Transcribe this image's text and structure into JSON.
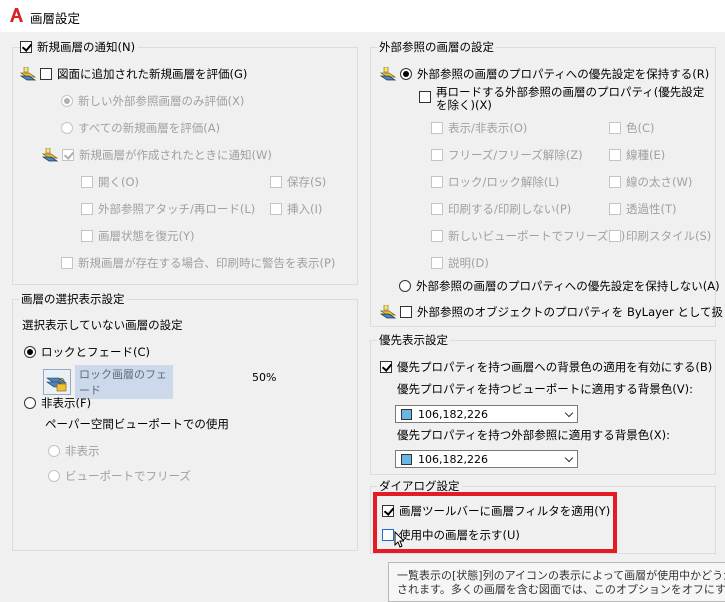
{
  "window": {
    "title": "画層設定"
  },
  "new_layer_notify": {
    "title": "新規画層の通知(N)",
    "evaluate_label": "図面に追加された新規画層を評価(G)",
    "xref_only_label": "新しい外部参照画層のみ評価(X)",
    "all_new_label": "すべての新規画層を評価(A)",
    "notify_label": "新規画層が作成されたときに通知(W)",
    "open_label": "開く(O)",
    "save_label": "保存(S)",
    "xref_attach_label": "外部参照アタッチ/再ロード(L)",
    "insert_label": "挿入(I)",
    "restore_label": "画層状態を復元(Y)",
    "plot_warn_label": "新規画層が存在する場合、印刷時に警告を表示(P)"
  },
  "layer_isolation": {
    "title": "画層の選択表示設定",
    "subtitle": "選択表示していない画層の設定",
    "lock_fade_label": "ロックとフェード(C)",
    "fade_label": "ロック画層のフェード",
    "fade_value": "50%",
    "off_label": "非表示(F)",
    "paper_space_label": "ペーパー空間ビューポートでの使用",
    "hide_label": "非表示",
    "vp_freeze_label": "ビューポートでフリーズ"
  },
  "xref_settings": {
    "title": "外部参照の画層の設定",
    "retain_label": "外部参照の画層のプロパティへの優先設定を保持する(R)",
    "reload_remove_label_1": "再ロードする外部参照の画層のプロパティ(優先設定",
    "reload_remove_label_2": "を除く)(X)",
    "on_off": "表示/非表示(O)",
    "color": "色(C)",
    "freeze": "フリーズ/フリーズ解除(Z)",
    "linetype": "線種(E)",
    "lock": "ロック/ロック解除(L)",
    "lineweight": "線の太さ(W)",
    "plot": "印刷する/印刷しない(P)",
    "transparency": "透過性(T)",
    "new_vp_freeze": "新しいビューポートでフリーズ(V)",
    "plot_style": "印刷スタイル(S)",
    "description": "説明(D)",
    "no_retain_label": "外部参照の画層のプロパティへの優先設定を保持しない(A)",
    "bylayer_label": "外部参照のオブジェクトのプロパティを ByLayer として扱う(T)"
  },
  "override_display": {
    "title": "優先表示設定",
    "enable_label": "優先プロパティを持つ画層への背景色の適用を有効にする(B)",
    "vp_color_label": "優先プロパティを持つビューポートに適用する背景色(V):",
    "vp_color_value": "106,182,226",
    "xref_color_label": "優先プロパティを持つ外部参照に適用する背景色(X):",
    "xref_color_value": "106,182,226"
  },
  "dialog_settings": {
    "title": "ダイアログ設定",
    "filter_label": "画層ツールバーに画層フィルタを適用(Y)",
    "indicate_label": "使用中の画層を示す(U)"
  },
  "tooltip": {
    "line1": "一覧表示の[状態]列のアイコンの表示によって画層が使用中かどうか",
    "line2": "されます。多くの画層を含む図面では、このオプションをオフにすると パフ"
  },
  "colors": {
    "swatch": "#6ab6e2",
    "highlight": "#e51b23",
    "accent": "#1a6fd0"
  }
}
